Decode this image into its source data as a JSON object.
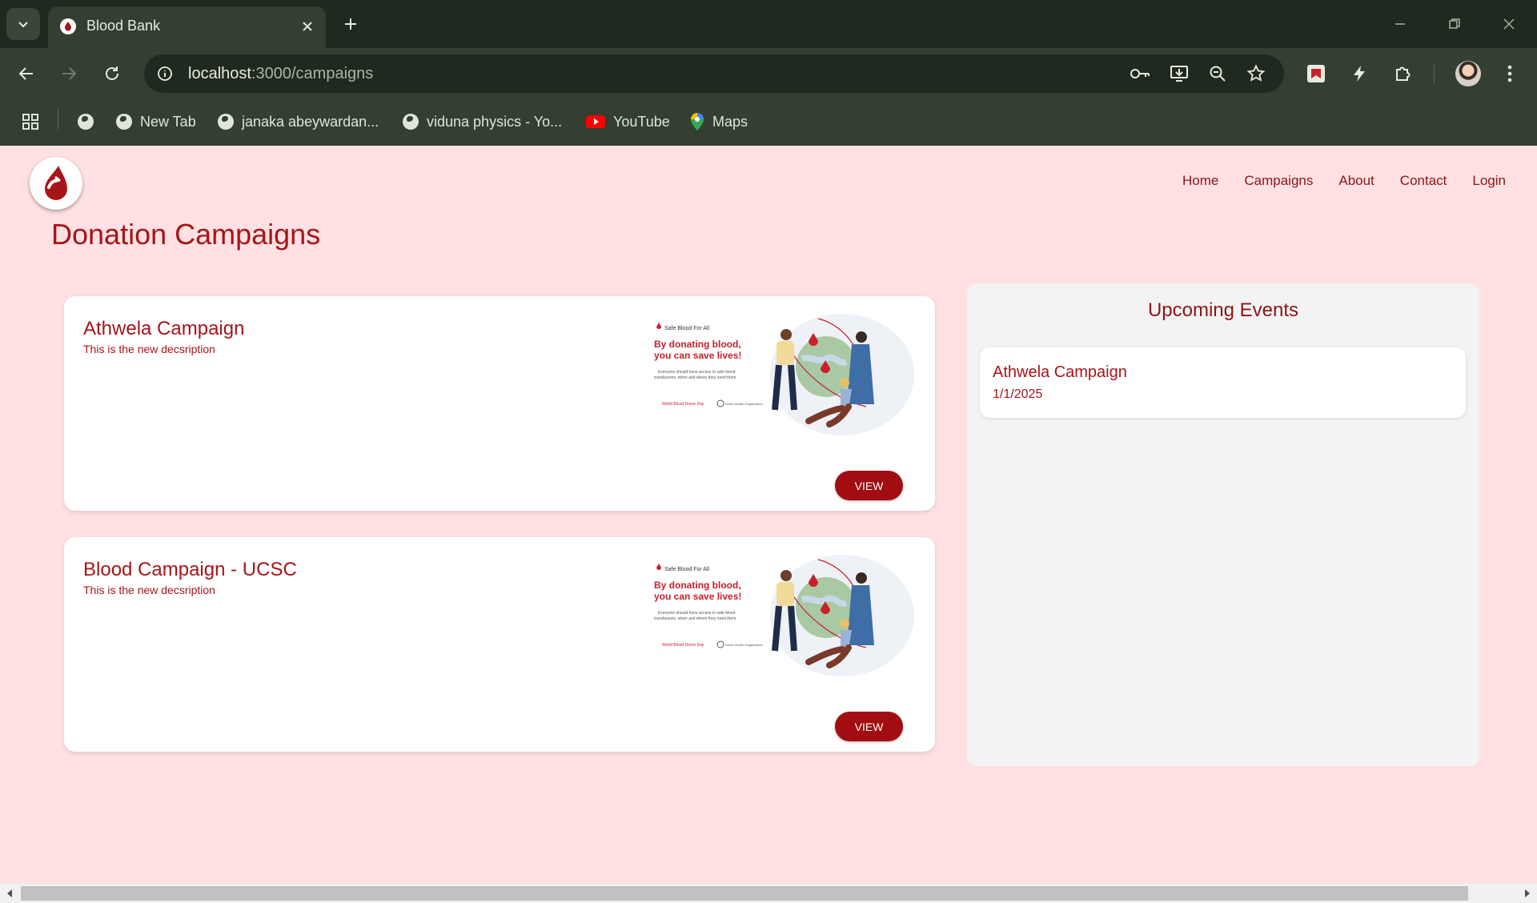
{
  "browser": {
    "tab_title": "Blood Bank",
    "url_host": "localhost",
    "url_path": ":3000/campaigns",
    "bookmarks": [
      {
        "label": "New Tab",
        "icon": "globe-icon"
      },
      {
        "label": "janaka abeywardan...",
        "icon": "globe-icon"
      },
      {
        "label": "viduna physics - Yo...",
        "icon": "globe-icon"
      },
      {
        "label": "YouTube",
        "icon": "youtube-icon"
      },
      {
        "label": "Maps",
        "icon": "maps-icon"
      }
    ]
  },
  "nav": {
    "home": "Home",
    "campaigns": "Campaigns",
    "about": "About",
    "contact": "Contact",
    "login": "Login"
  },
  "page": {
    "title": "Donation Campaigns"
  },
  "campaigns": [
    {
      "title": "Athwela Campaign",
      "description": "This is the new decsription",
      "button": "VIEW"
    },
    {
      "title": "Blood Campaign - UCSC",
      "description": "This is the new decsription",
      "button": "VIEW"
    }
  ],
  "poster": {
    "tag": "Safe Blood For All",
    "headline_1": "By donating blood,",
    "headline_2": "you can save lives!",
    "body_1": "Everyone should have access to safe blood",
    "body_2": "transfusions, when and where they need them.",
    "footer_left": "World Blood Donor Day",
    "footer_right": "World Health Organization"
  },
  "events": {
    "title": "Upcoming Events",
    "items": [
      {
        "name": "Athwela Campaign",
        "date": "1/1/2025"
      }
    ]
  },
  "colors": {
    "brand_red": "#a71419",
    "page_bg": "#ffe1e3",
    "button_red": "#a20d12",
    "chrome_dark": "#20291f",
    "chrome_toolbar": "#333f30"
  }
}
